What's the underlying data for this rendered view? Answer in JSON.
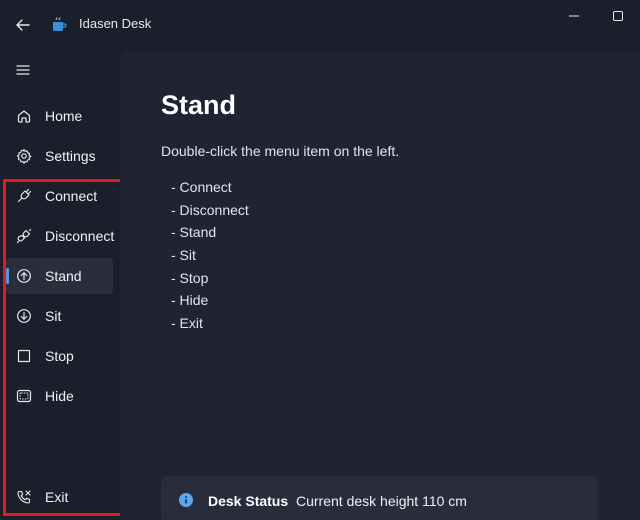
{
  "window": {
    "title": "Idasen Desk"
  },
  "sidebar": {
    "items": [
      {
        "id": "home",
        "label": "Home",
        "icon": "home-icon"
      },
      {
        "id": "settings",
        "label": "Settings",
        "icon": "gear-icon"
      },
      {
        "id": "connect",
        "label": "Connect",
        "icon": "plug-connect-icon"
      },
      {
        "id": "disconnect",
        "label": "Disconnect",
        "icon": "plug-disconnect-icon"
      },
      {
        "id": "stand",
        "label": "Stand",
        "icon": "arrow-up-circle-icon",
        "selected": true
      },
      {
        "id": "sit",
        "label": "Sit",
        "icon": "arrow-down-circle-icon"
      },
      {
        "id": "stop",
        "label": "Stop",
        "icon": "stop-square-icon"
      },
      {
        "id": "hide",
        "label": "Hide",
        "icon": "hide-window-icon"
      }
    ],
    "footer_item": {
      "id": "exit",
      "label": "Exit",
      "icon": "exit-phone-icon"
    }
  },
  "content": {
    "title": "Stand",
    "instruction": "Double-click the menu item on the left.",
    "commands": [
      "- Connect",
      "- Disconnect",
      "- Stand",
      "- Sit",
      "- Stop",
      "- Hide",
      "- Exit"
    ]
  },
  "status": {
    "title": "Desk Status",
    "message": "Current desk height 110 cm"
  },
  "colors": {
    "accent": "#4c9be8",
    "highlight_border": "#e21b23",
    "window_bg": "#1b1e2b",
    "content_bg": "#202331"
  }
}
